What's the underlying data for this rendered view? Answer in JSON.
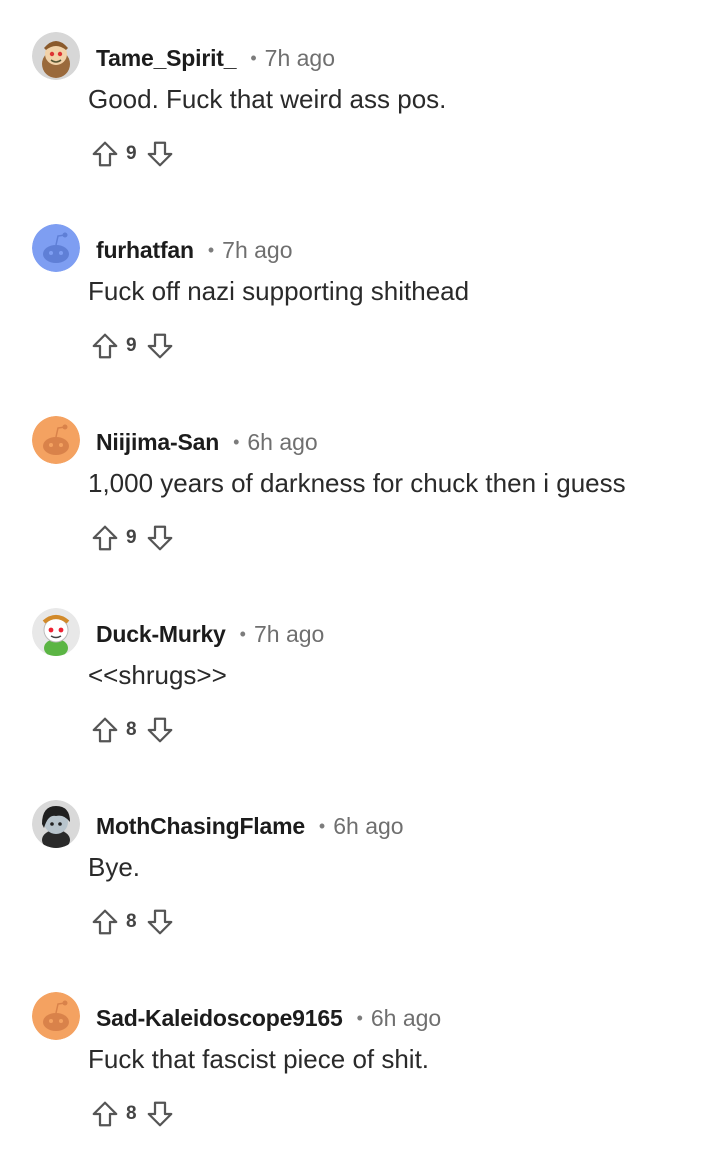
{
  "comments": [
    {
      "username": "Tame_Spirit_",
      "separator": "•",
      "time": "7h ago",
      "text": "Good. Fuck that weird ass pos.",
      "score": "9",
      "avatar_color": "#9a6a3c",
      "avatar_icon": "snoo-hat-avatar-icon"
    },
    {
      "username": "furhatfan",
      "separator": "•",
      "time": "7h ago",
      "text": "Fuck off nazi supporting shithead",
      "score": "9",
      "avatar_color": "#7e9ef2",
      "avatar_icon": "default-snoo-avatar-icon"
    },
    {
      "username": "Niijima-San",
      "separator": "•",
      "time": "6h ago",
      "text": "1,000 years of darkness for chuck then i guess",
      "score": "9",
      "avatar_color": "#f4a261",
      "avatar_icon": "default-snoo-avatar-icon"
    },
    {
      "username": "Duck-Murky",
      "separator": "•",
      "time": "7h ago",
      "text": "<<shrugs>>",
      "score": "8",
      "avatar_color": "#e8e8e8",
      "avatar_icon": "snoo-custom-avatar-icon"
    },
    {
      "username": "MothChasingFlame",
      "separator": "•",
      "time": "6h ago",
      "text": "Bye.",
      "score": "8",
      "avatar_color": "#3a3a3a",
      "avatar_icon": "dark-character-avatar-icon"
    },
    {
      "username": "Sad-Kaleidoscope9165",
      "separator": "•",
      "time": "6h ago",
      "text": "Fuck that fascist piece of shit.",
      "score": "8",
      "avatar_color": "#f4a261",
      "avatar_icon": "default-snoo-avatar-icon"
    }
  ]
}
